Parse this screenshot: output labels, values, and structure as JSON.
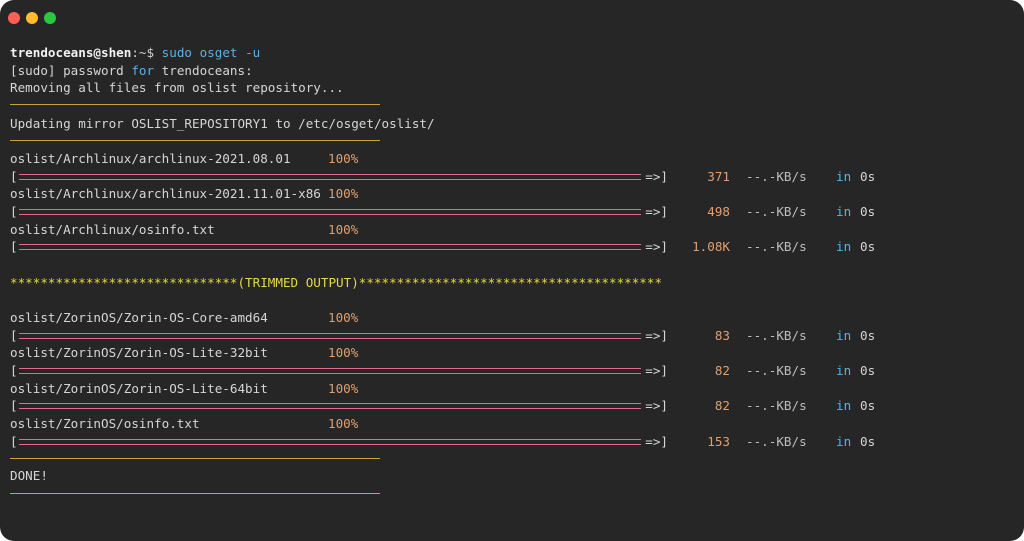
{
  "window": {
    "lights": [
      {
        "name": "close-light",
        "color": "#ff5f57"
      },
      {
        "name": "minimize-light",
        "color": "#febc2e"
      },
      {
        "name": "maximize-light",
        "color": "#28c840"
      }
    ]
  },
  "prompt": {
    "user_host": "trendoceans@shen",
    "path": ":~$",
    "command": "sudo osget -u"
  },
  "lines": {
    "sudo_prefix": "[sudo] password ",
    "sudo_for": "for",
    "sudo_suffix": " trendoceans:",
    "removing": "Removing all files from oslist repository...",
    "updating": "Updating mirror OSLIST_REPOSITORY1 to /etc/osget/oslist/",
    "trimmed": "******************************(TRIMMED OUTPUT)****************************************",
    "done": "DONE!"
  },
  "bar_glyphs": {
    "left": "[",
    "right": "=>]"
  },
  "transfer_label": {
    "rate": "--.-KB/s",
    "in": "in",
    "time": "0s"
  },
  "downloads_top": [
    {
      "file": "oslist/Archlinux/archlinux-2021.08.01",
      "percent": "100%",
      "size": "371",
      "progress": 1.0
    },
    {
      "file": "oslist/Archlinux/archlinux-2021.11.01-x86",
      "percent": "100%",
      "size": "498",
      "progress": 1.0
    },
    {
      "file": "oslist/Archlinux/osinfo.txt",
      "percent": "100%",
      "size": "1.08K",
      "progress": 1.0
    }
  ],
  "downloads_bottom": [
    {
      "file": "oslist/ZorinOS/Zorin-OS-Core-amd64",
      "percent": "100%",
      "size": "83",
      "progress": 1.0
    },
    {
      "file": "oslist/ZorinOS/Zorin-OS-Lite-32bit",
      "percent": "100%",
      "size": "82",
      "progress": 1.0
    },
    {
      "file": "oslist/ZorinOS/Zorin-OS-Lite-64bit",
      "percent": "100%",
      "size": "82",
      "progress": 1.0
    },
    {
      "file": "oslist/ZorinOS/osinfo.txt",
      "percent": "100%",
      "size": "153",
      "progress": 1.0
    }
  ],
  "colors": {
    "background": "#262626",
    "prompt_blue": "#59b2e6",
    "percent_orange": "#e0a070",
    "progress_pink": "#e36a8c",
    "separator_gold": "#c8a23a",
    "trimmed_yellow": "#e5d94a"
  }
}
